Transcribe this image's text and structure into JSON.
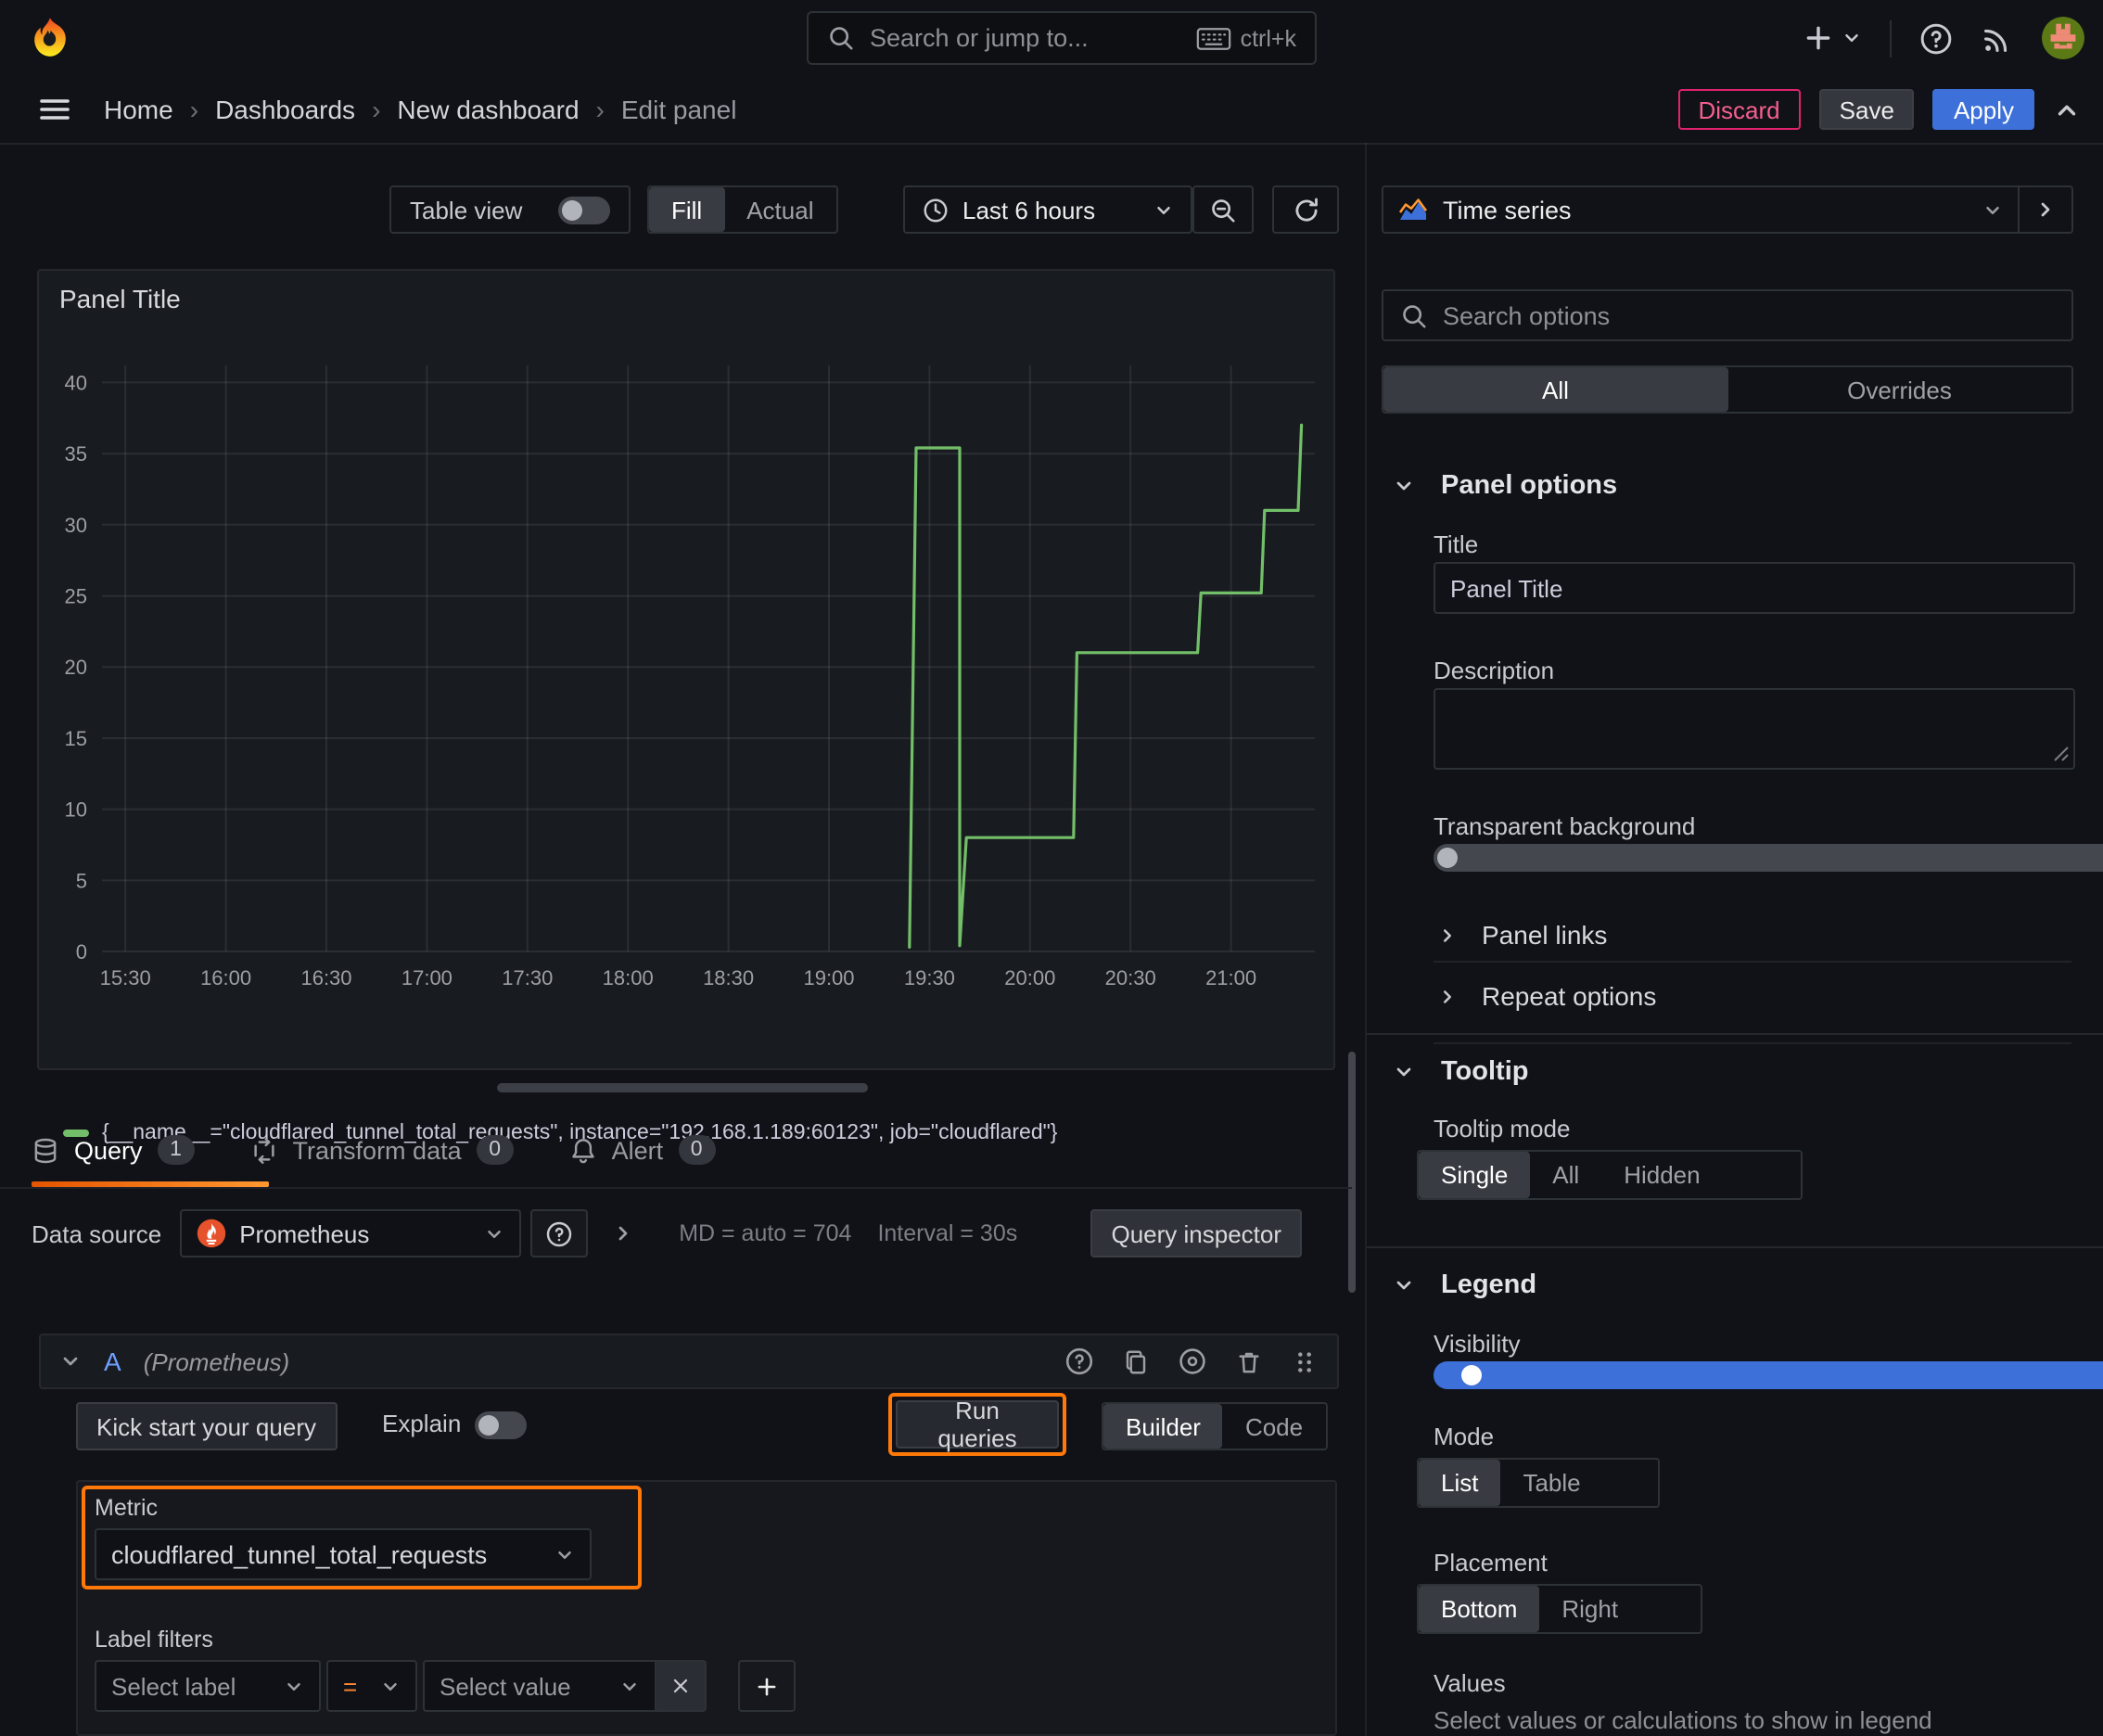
{
  "topbar": {
    "search_placeholder": "Search or jump to...",
    "search_shortcut": "ctrl+k"
  },
  "nav": {
    "breadcrumb": [
      "Home",
      "Dashboards",
      "New dashboard",
      "Edit panel"
    ],
    "discard": "Discard",
    "save": "Save",
    "apply": "Apply"
  },
  "toolbar": {
    "table_view": "Table view",
    "fill_actual": {
      "options": [
        "Fill",
        "Actual"
      ],
      "selected": 0
    },
    "time_range": "Last 6 hours"
  },
  "panel": {
    "title": "Panel Title"
  },
  "editor": {
    "tabs": [
      {
        "label": "Query",
        "badge": "1",
        "icon": "database"
      },
      {
        "label": "Transform data",
        "badge": "0",
        "icon": "transform"
      },
      {
        "label": "Alert",
        "badge": "0",
        "icon": "bell"
      }
    ],
    "datasource_label": "Data source",
    "datasource_value": "Prometheus",
    "stats_md": "MD = auto = 704",
    "stats_interval": "Interval = 30s",
    "query_inspector": "Query inspector",
    "query_ref": "A",
    "query_ds_hint": "(Prometheus)",
    "kick_start": "Kick start your query",
    "explain": "Explain",
    "run_queries": "Run queries",
    "builder_code": {
      "options": [
        "Builder",
        "Code"
      ],
      "selected": 0
    },
    "metric_label": "Metric",
    "metric_value": "cloudflared_tunnel_total_requests",
    "label_filters_label": "Label filters",
    "select_label_placeholder": "Select label",
    "operator": "=",
    "select_value_placeholder": "Select value"
  },
  "sidebar": {
    "viz_type": "Time series",
    "search_placeholder": "Search options",
    "scope_tabs": {
      "options": [
        "All",
        "Overrides"
      ],
      "selected": 0
    },
    "panel_options": {
      "header": "Panel options",
      "title_label": "Title",
      "title_value": "Panel Title",
      "description_label": "Description",
      "transparent_label": "Transparent background",
      "panel_links": "Panel links",
      "repeat_options": "Repeat options"
    },
    "tooltip": {
      "header": "Tooltip",
      "mode_label": "Tooltip mode",
      "mode": {
        "options": [
          "Single",
          "All",
          "Hidden"
        ],
        "selected": 0
      }
    },
    "legend": {
      "header": "Legend",
      "visibility_label": "Visibility",
      "mode_label": "Mode",
      "mode": {
        "options": [
          "List",
          "Table"
        ],
        "selected": 0
      },
      "placement_label": "Placement",
      "placement": {
        "options": [
          "Bottom",
          "Right"
        ],
        "selected": 0
      },
      "values_label": "Values",
      "values_hint": "Select values or calculations to show in legend"
    }
  },
  "chart_data": {
    "type": "line",
    "title": "Panel Title",
    "x_ticks": [
      "15:30",
      "16:00",
      "16:30",
      "17:00",
      "17:30",
      "18:00",
      "18:30",
      "19:00",
      "19:30",
      "20:00",
      "20:30",
      "21:00"
    ],
    "y_ticks": [
      0,
      5,
      10,
      15,
      20,
      25,
      30,
      35,
      40
    ],
    "ylim": [
      0,
      41.2
    ],
    "x_start": "15:23",
    "x_end": "21:25",
    "grid": true,
    "legend_position": "bottom",
    "series": [
      {
        "name": "{__name__=\"cloudflared_tunnel_total_requests\", instance=\"192.168.1.189:60123\", job=\"cloudflared\"}",
        "color": "#73bf69",
        "points": [
          [
            "19:24",
            0.3
          ],
          [
            "19:26",
            35.4
          ],
          [
            "19:39",
            35.4
          ],
          [
            "19:39",
            0.4
          ],
          [
            "19:41",
            8
          ],
          [
            "20:13",
            8
          ],
          [
            "20:14",
            21
          ],
          [
            "20:50",
            21
          ],
          [
            "20:51",
            25.2
          ],
          [
            "21:09",
            25.2
          ],
          [
            "21:10",
            31
          ],
          [
            "21:20",
            31
          ],
          [
            "21:21",
            37
          ]
        ]
      }
    ]
  },
  "colors": {
    "accent_orange": "#ff780a",
    "apply_blue": "#3d71d9",
    "discard_pink": "#e0226e",
    "series_green": "#73bf69"
  }
}
